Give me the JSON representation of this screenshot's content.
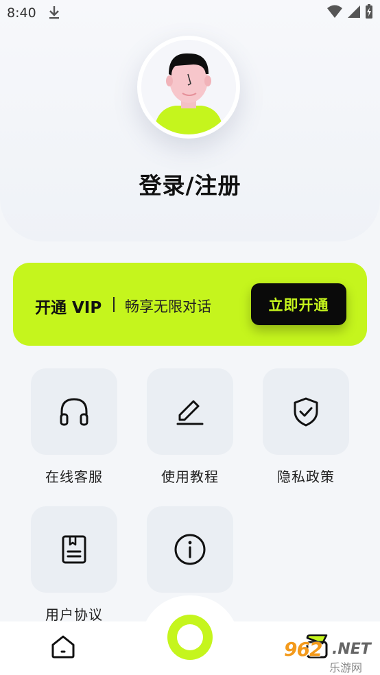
{
  "status_bar": {
    "time": "8:40"
  },
  "header": {
    "login_label": "登录/注册"
  },
  "vip": {
    "title": "开通 VIP",
    "description": "畅享无限对话",
    "button_label": "立即开通"
  },
  "menu": {
    "items": [
      {
        "label": "在线客服",
        "icon": "headphones-icon"
      },
      {
        "label": "使用教程",
        "icon": "edit-icon"
      },
      {
        "label": "隐私政策",
        "icon": "shield-check-icon"
      },
      {
        "label": "用户协议",
        "icon": "book-icon"
      },
      {
        "label": "",
        "icon": "info-icon"
      }
    ]
  },
  "bottom_nav": {
    "items": [
      {
        "icon": "home-icon"
      },
      {
        "icon": "center-action-icon"
      },
      {
        "icon": "profile-icon"
      }
    ]
  },
  "watermark": {
    "main": "962",
    "suffix": ".NET",
    "sub": "乐游网"
  },
  "colors": {
    "accent": "#c5f51d",
    "dark": "#0a0a0a",
    "tile": "#eaeef3",
    "background": "#f4f6f9"
  }
}
